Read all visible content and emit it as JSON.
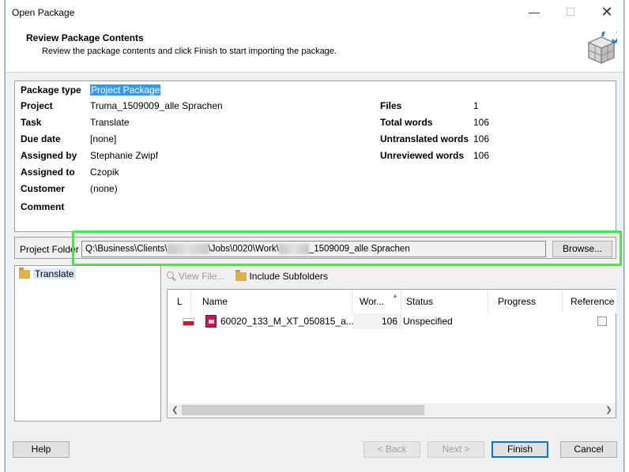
{
  "window": {
    "title": "Open Package",
    "minimize_glyph": "—",
    "maximize_glyph": "☐",
    "close_glyph": "✕"
  },
  "header": {
    "title": "Review Package Contents",
    "subtitle": "Review the package contents and click Finish to start importing the package.",
    "icon": "package-box-icon"
  },
  "package_info": {
    "package_type_label": "Package type",
    "package_type": "Project Package",
    "project_label": "Project",
    "project": "Truma_1509009_alle Sprachen",
    "task_label": "Task",
    "task": "Translate",
    "due_date_label": "Due date",
    "due_date": "[none]",
    "assigned_by_label": "Assigned by",
    "assigned_by": "Stephanie Zwipf",
    "assigned_to_label": "Assigned to",
    "assigned_to": "Czopik",
    "customer_label": "Customer",
    "customer": "(none)",
    "comment_label": "Comment"
  },
  "stats": {
    "files_label": "Files",
    "files": "1",
    "total_words_label": "Total words",
    "total_words": "106",
    "untranslated_label": "Untranslated words",
    "untranslated": "106",
    "unreviewed_label": "Unreviewed words",
    "unreviewed": "106"
  },
  "project_folder": {
    "label": "Project Folder",
    "path_part1": "Q:\\Business\\Clients\\",
    "path_part2": "\\Jobs\\0020\\Work\\",
    "path_part3": "_1509009_alle Sprachen",
    "browse_label": "Browse..."
  },
  "tree": {
    "items": [
      {
        "label": "Translate"
      }
    ]
  },
  "toolbar": {
    "view_file": "View File...",
    "include_subfolders": "Include Subfolders"
  },
  "file_table": {
    "columns": [
      "L",
      "Name",
      "Wor...",
      "Status",
      "Progress",
      "Reference"
    ],
    "rows": [
      {
        "name": "60020_133_M_XT_050815_a...",
        "words": "106",
        "status": "Unspecified"
      }
    ]
  },
  "buttons": {
    "help": "Help",
    "back": "< Back",
    "next": "Next >",
    "finish": "Finish",
    "cancel": "Cancel"
  },
  "colors": {
    "highlight": "#53e04a",
    "selection": "#3399ff",
    "accent": "#0078d7"
  }
}
